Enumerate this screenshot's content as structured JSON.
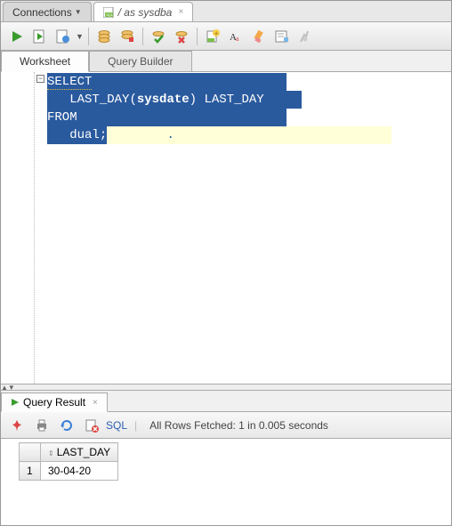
{
  "top_tabs": {
    "connections": "Connections",
    "active": "/ as sysdba"
  },
  "sub_tabs": {
    "worksheet": "Worksheet",
    "query_builder": "Query Builder"
  },
  "sql": {
    "line1": "SELECT",
    "line2_indent": "   ",
    "line2_fn": "LAST_DAY",
    "line2_paren_open": "(",
    "line2_arg": "sysdate",
    "line2_paren_close": ")",
    "line2_space": " ",
    "line2_alias": "LAST_DAY",
    "line3": "FROM",
    "line4_indent": "   ",
    "line4_table": "dual",
    "line4_semi": ";"
  },
  "result": {
    "tab_label": "Query Result",
    "sql_link": "SQL",
    "status": "All Rows Fetched: 1 in 0.005 seconds",
    "columns": [
      "LAST_DAY"
    ],
    "rows": [
      {
        "n": "1",
        "LAST_DAY": "30-04-20"
      }
    ]
  }
}
